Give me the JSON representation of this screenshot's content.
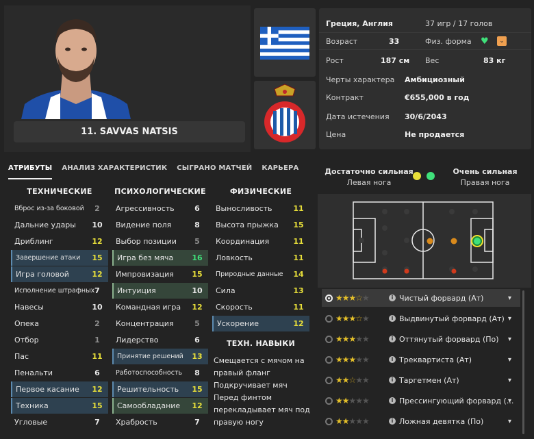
{
  "player": {
    "name": "11. SAVVAS NATSIS"
  },
  "info": {
    "nationality": "Греция, Англия",
    "caps": "37 игр / 17 голов",
    "age_label": "Возраст",
    "age": "33",
    "fitness_label": "Физ. форма",
    "height_label": "Рост",
    "height": "187 см",
    "weight_label": "Вес",
    "weight": "83 кг",
    "personality_label": "Черты характера",
    "personality": "Амбициозный",
    "contract_label": "Контракт",
    "contract": "€655,000 в год",
    "expiry_label": "Дата истечения",
    "expiry": "30/6/2043",
    "value_label": "Цена",
    "value": "Не продается"
  },
  "tabs": [
    "АТРИБУТЫ",
    "АНАЛИЗ ХАРАКТЕРИСТИК",
    "СЫГРАНО МАТЧЕЙ",
    "КАРЬЕРА"
  ],
  "columns": {
    "technical": "ТЕХНИЧЕСКИЕ",
    "mental": "ПСИХОЛОГИЧЕСКИЕ",
    "physical": "ФИЗИЧЕСКИЕ",
    "tech_skills": "ТЕХН. НАВЫКИ"
  },
  "technical": [
    {
      "name": "Вброс из-за боковой",
      "value": "2"
    },
    {
      "name": "Дальние удары",
      "value": "10"
    },
    {
      "name": "Дриблинг",
      "value": "12"
    },
    {
      "name": "Завершение атаки",
      "value": "15"
    },
    {
      "name": "Игра головой",
      "value": "12"
    },
    {
      "name": "Исполнение штрафных",
      "value": "7"
    },
    {
      "name": "Навесы",
      "value": "10"
    },
    {
      "name": "Опека",
      "value": "2"
    },
    {
      "name": "Отбор",
      "value": "1"
    },
    {
      "name": "Пас",
      "value": "11"
    },
    {
      "name": "Пенальти",
      "value": "6"
    },
    {
      "name": "Первое касание",
      "value": "12"
    },
    {
      "name": "Техника",
      "value": "15"
    },
    {
      "name": "Угловые",
      "value": "7"
    }
  ],
  "mental": [
    {
      "name": "Агрессивность",
      "value": "6"
    },
    {
      "name": "Видение поля",
      "value": "8"
    },
    {
      "name": "Выбор позиции",
      "value": "5"
    },
    {
      "name": "Игра без мяча",
      "value": "16"
    },
    {
      "name": "Импровизация",
      "value": "15"
    },
    {
      "name": "Интуиция",
      "value": "10"
    },
    {
      "name": "Командная игра",
      "value": "12"
    },
    {
      "name": "Концентрация",
      "value": "5"
    },
    {
      "name": "Лидерство",
      "value": "6"
    },
    {
      "name": "Принятие решений",
      "value": "13"
    },
    {
      "name": "Работоспособность",
      "value": "8"
    },
    {
      "name": "Решительность",
      "value": "15"
    },
    {
      "name": "Самообладание",
      "value": "12"
    },
    {
      "name": "Храбрость",
      "value": "7"
    }
  ],
  "physical": [
    {
      "name": "Выносливость",
      "value": "11"
    },
    {
      "name": "Высота прыжка",
      "value": "15"
    },
    {
      "name": "Координация",
      "value": "11"
    },
    {
      "name": "Ловкость",
      "value": "11"
    },
    {
      "name": "Природные данные",
      "value": "14"
    },
    {
      "name": "Сила",
      "value": "13"
    },
    {
      "name": "Скорость",
      "value": "11"
    },
    {
      "name": "Ускорение",
      "value": "12"
    }
  ],
  "tech_skills_text": "Смещается с мячом на правый фланг\nПодкручивает мяч\nПеред финтом перекладывает мяч под правую ногу",
  "feet": {
    "left_strength": "Достаточно сильная",
    "left_label": "Левая нога",
    "right_strength": "Очень сильная",
    "right_label": "Правая нога",
    "left_color": "#e8df3a",
    "right_color": "#3fe07a"
  },
  "roles": [
    {
      "stars": "★★★",
      "half": true,
      "empty": "★",
      "name": "Чистый форвард (Ат)"
    },
    {
      "stars": "★★★",
      "half": true,
      "empty": "★",
      "name": "Выдвинутый форвард (Ат)"
    },
    {
      "stars": "★★★",
      "half": false,
      "empty": "★★",
      "name": "Оттянутый форвард (По)"
    },
    {
      "stars": "★★★",
      "half": false,
      "empty": "★★",
      "name": "Треквартиста (Ат)"
    },
    {
      "stars": "★★",
      "half": true,
      "empty": "★★",
      "name": "Таргетмен (Ат)"
    },
    {
      "stars": "★★",
      "half": false,
      "empty": "★★★",
      "name": "Прессингующий форвард (..."
    },
    {
      "stars": "★★",
      "half": false,
      "empty": "★★★",
      "name": "Ложная девятка (По)"
    }
  ]
}
